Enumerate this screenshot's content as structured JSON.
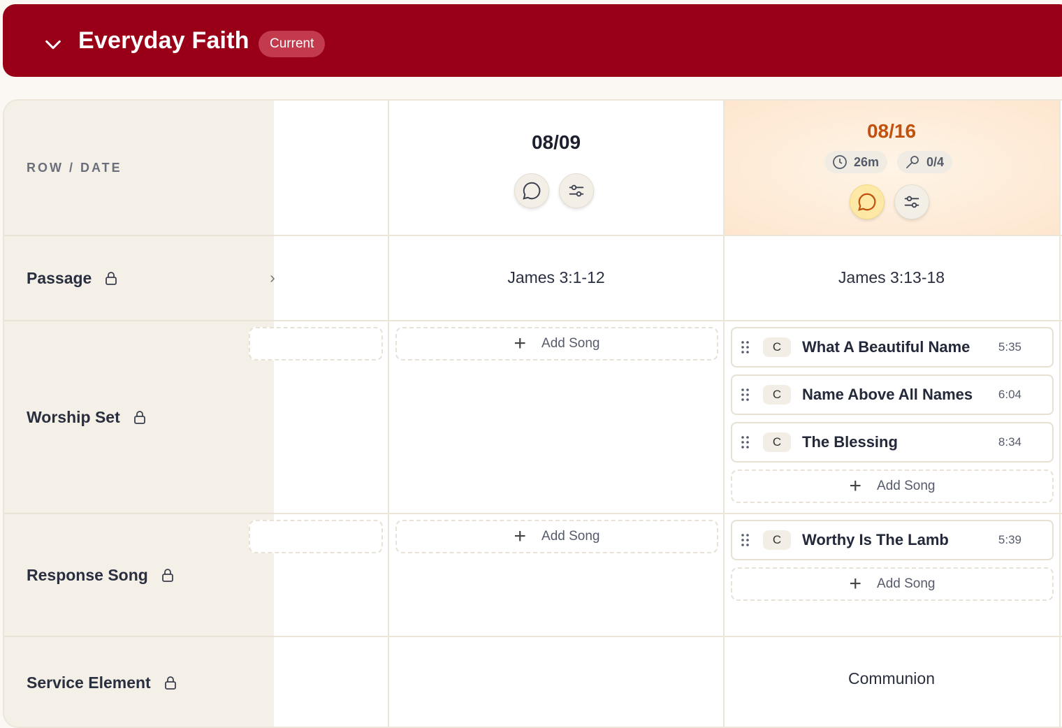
{
  "banner": {
    "title": "Everyday Faith",
    "badge": "Current"
  },
  "grid": {
    "header_label": "ROW / DATE",
    "rows": [
      {
        "label": "Passage"
      },
      {
        "label": "Worship Set"
      },
      {
        "label": "Response Song"
      },
      {
        "label": "Service Element"
      }
    ],
    "partial_column": {
      "passage_fragment": "›"
    },
    "columns": [
      {
        "date": "08/09",
        "passage": "James 3:1-12",
        "worship_add": "Add Song",
        "response_add": "Add Song"
      },
      {
        "date": "08/16",
        "duration": "26m",
        "assigned": "0/4",
        "passage": "James 3:13-18",
        "worship_songs": [
          {
            "key": "C",
            "title": "What A Beautiful Name",
            "duration": "5:35"
          },
          {
            "key": "C",
            "title": "Name Above All Names",
            "duration": "6:04"
          },
          {
            "key": "C",
            "title": "The Blessing",
            "duration": "8:34"
          }
        ],
        "worship_add": "Add Song",
        "response_songs": [
          {
            "key": "C",
            "title": "Worthy Is The Lamb",
            "duration": "5:39"
          }
        ],
        "response_add": "Add Song",
        "service_element": "Communion"
      }
    ]
  },
  "colors": {
    "banner": "#990018",
    "highlight_date": "#c0510f",
    "accent": "#f3d982"
  }
}
